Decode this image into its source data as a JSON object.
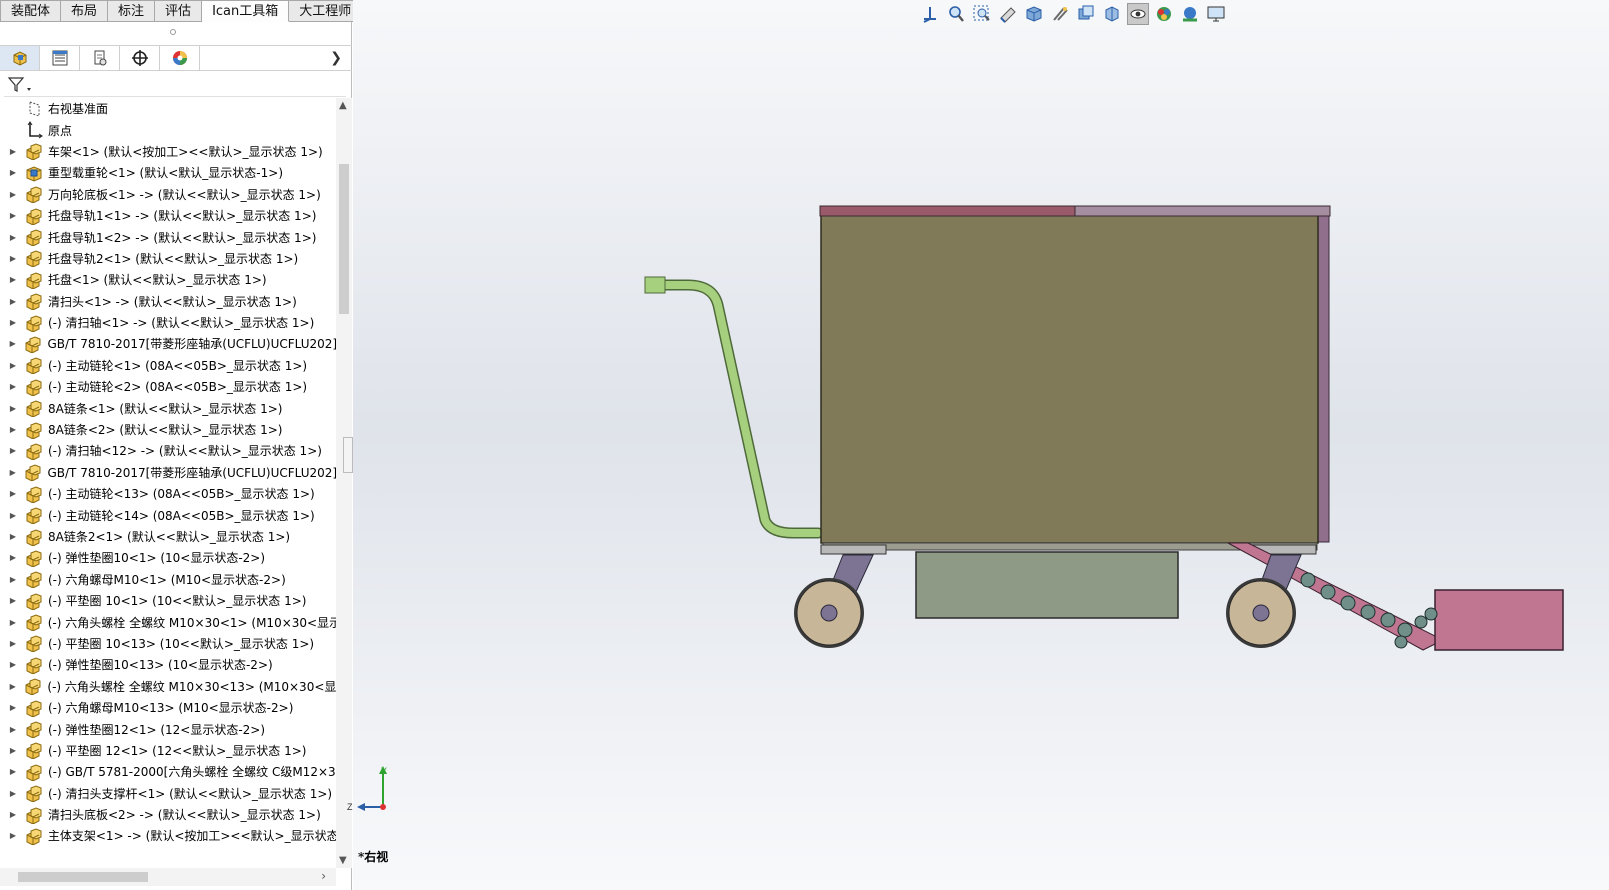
{
  "tabs": [
    "装配体",
    "布局",
    "标注",
    "评估",
    "Ican工具箱",
    "大工程师"
  ],
  "panel": {
    "icon_tabs": [
      "featuremanager-icon",
      "propertymanager-icon",
      "configurationmanager-icon",
      "dimxpert-icon",
      "display-manager-icon"
    ],
    "filter_icon": "filter-icon",
    "tree": [
      {
        "label": "右视基准面",
        "icon": "plane-icon",
        "expandable": false
      },
      {
        "label": "原点",
        "icon": "origin-icon",
        "expandable": false
      },
      {
        "label": "车架<1> (默认<按加工><<默认>_显示状态 1>)",
        "icon": "subassembly-icon",
        "expandable": true
      },
      {
        "label": "重型载重轮<1> (默认<默认_显示状态-1>)",
        "icon": "assembly-icon",
        "expandable": true
      },
      {
        "label": "万向轮底板<1> -> (默认<<默认>_显示状态 1>)",
        "icon": "subassembly-icon",
        "expandable": true
      },
      {
        "label": "托盘导轨1<1> -> (默认<<默认>_显示状态 1>)",
        "icon": "subassembly-icon",
        "expandable": true
      },
      {
        "label": "托盘导轨1<2> -> (默认<<默认>_显示状态 1>)",
        "icon": "subassembly-icon",
        "expandable": true
      },
      {
        "label": "托盘导轨2<1> (默认<<默认>_显示状态 1>)",
        "icon": "subassembly-icon",
        "expandable": true
      },
      {
        "label": "托盘<1> (默认<<默认>_显示状态 1>)",
        "icon": "subassembly-icon",
        "expandable": true
      },
      {
        "label": "清扫头<1> -> (默认<<默认>_显示状态 1>)",
        "icon": "subassembly-icon",
        "expandable": true
      },
      {
        "label": "(-) 清扫轴<1> -> (默认<<默认>_显示状态 1>)",
        "icon": "subassembly-icon",
        "expandable": true
      },
      {
        "label": "GB/T 7810-2017[带菱形座轴承(UCFLU)UCFLU202]<",
        "icon": "subassembly-icon",
        "expandable": true
      },
      {
        "label": "(-) 主动链轮<1> (08A<<05B>_显示状态 1>)",
        "icon": "subassembly-icon",
        "expandable": true
      },
      {
        "label": "(-) 主动链轮<2> (08A<<05B>_显示状态 1>)",
        "icon": "subassembly-icon",
        "expandable": true
      },
      {
        "label": "8A链条<1> (默认<<默认>_显示状态 1>)",
        "icon": "subassembly-icon",
        "expandable": true
      },
      {
        "label": "8A链条<2> (默认<<默认>_显示状态 1>)",
        "icon": "subassembly-icon",
        "expandable": true
      },
      {
        "label": "(-) 清扫轴<12> -> (默认<<默认>_显示状态 1>)",
        "icon": "subassembly-icon",
        "expandable": true
      },
      {
        "label": "GB/T 7810-2017[带菱形座轴承(UCFLU)UCFLU202]<",
        "icon": "subassembly-icon",
        "expandable": true
      },
      {
        "label": "(-) 主动链轮<13> (08A<<05B>_显示状态 1>)",
        "icon": "subassembly-icon",
        "expandable": true
      },
      {
        "label": "(-) 主动链轮<14> (08A<<05B>_显示状态 1>)",
        "icon": "subassembly-icon",
        "expandable": true
      },
      {
        "label": "8A链条2<1> (默认<<默认>_显示状态 1>)",
        "icon": "subassembly-icon",
        "expandable": true
      },
      {
        "label": "(-) 弹性垫圈10<1> (10<显示状态-2>)",
        "icon": "subassembly-icon",
        "expandable": true
      },
      {
        "label": "(-) 六角螺母M10<1> (M10<显示状态-2>)",
        "icon": "subassembly-icon",
        "expandable": true
      },
      {
        "label": "(-) 平垫圈 10<1> (10<<默认>_显示状态 1>)",
        "icon": "subassembly-icon",
        "expandable": true
      },
      {
        "label": "(-) 六角头螺栓 全螺纹 M10×30<1> (M10×30<显示",
        "icon": "subassembly-icon",
        "expandable": true
      },
      {
        "label": "(-) 平垫圈 10<13> (10<<默认>_显示状态 1>)",
        "icon": "subassembly-icon",
        "expandable": true
      },
      {
        "label": "(-) 弹性垫圈10<13> (10<显示状态-2>)",
        "icon": "subassembly-icon",
        "expandable": true
      },
      {
        "label": "(-) 六角头螺栓 全螺纹 M10×30<13> (M10×30<显示",
        "icon": "subassembly-icon",
        "expandable": true
      },
      {
        "label": "(-) 六角螺母M10<13> (M10<显示状态-2>)",
        "icon": "subassembly-icon",
        "expandable": true
      },
      {
        "label": "(-) 弹性垫圈12<1> (12<显示状态-2>)",
        "icon": "subassembly-icon",
        "expandable": true
      },
      {
        "label": "(-) 平垫圈 12<1> (12<<默认>_显示状态 1>)",
        "icon": "subassembly-icon",
        "expandable": true
      },
      {
        "label": "(-) GB/T 5781-2000[六角头螺栓 全螺纹 C级M12×3",
        "icon": "subassembly-icon",
        "expandable": true
      },
      {
        "label": "(-) 清扫头支撑杆<1> (默认<<默认>_显示状态 1>)",
        "icon": "subassembly-icon",
        "expandable": true
      },
      {
        "label": "清扫头底板<2> -> (默认<<默认>_显示状态 1>)",
        "icon": "subassembly-icon",
        "expandable": true
      },
      {
        "label": "主体支架<1> -> (默认<按加工><<默认>_显示状态",
        "icon": "subassembly-icon",
        "expandable": true
      }
    ]
  },
  "viewport": {
    "view_name": "*右视",
    "toolbar": [
      "view-orientation-icon",
      "zoom-to-fit-icon",
      "zoom-to-area-icon",
      "previous-view-icon",
      "section-view-icon",
      "dynamic-annotation-icon",
      "view-orientation-menu-icon",
      "display-style-icon",
      "hide-show-items-icon",
      "edit-appearance-icon",
      "apply-scene-icon",
      "view-settings-icon"
    ],
    "triad_axes": [
      "Y",
      "Z"
    ]
  },
  "colors": {
    "body": "#807a58",
    "lid_left": "#9a5a6a",
    "lid_right": "#a48ea0",
    "back_panel": "#8f6f8c",
    "handle": "#a6cf7e",
    "tray": "#8e9a86",
    "wheel_tire": "#c8b698",
    "caster": "#7d7392",
    "brush_head": "#c07590",
    "folder_icon": "#f0c14b"
  }
}
